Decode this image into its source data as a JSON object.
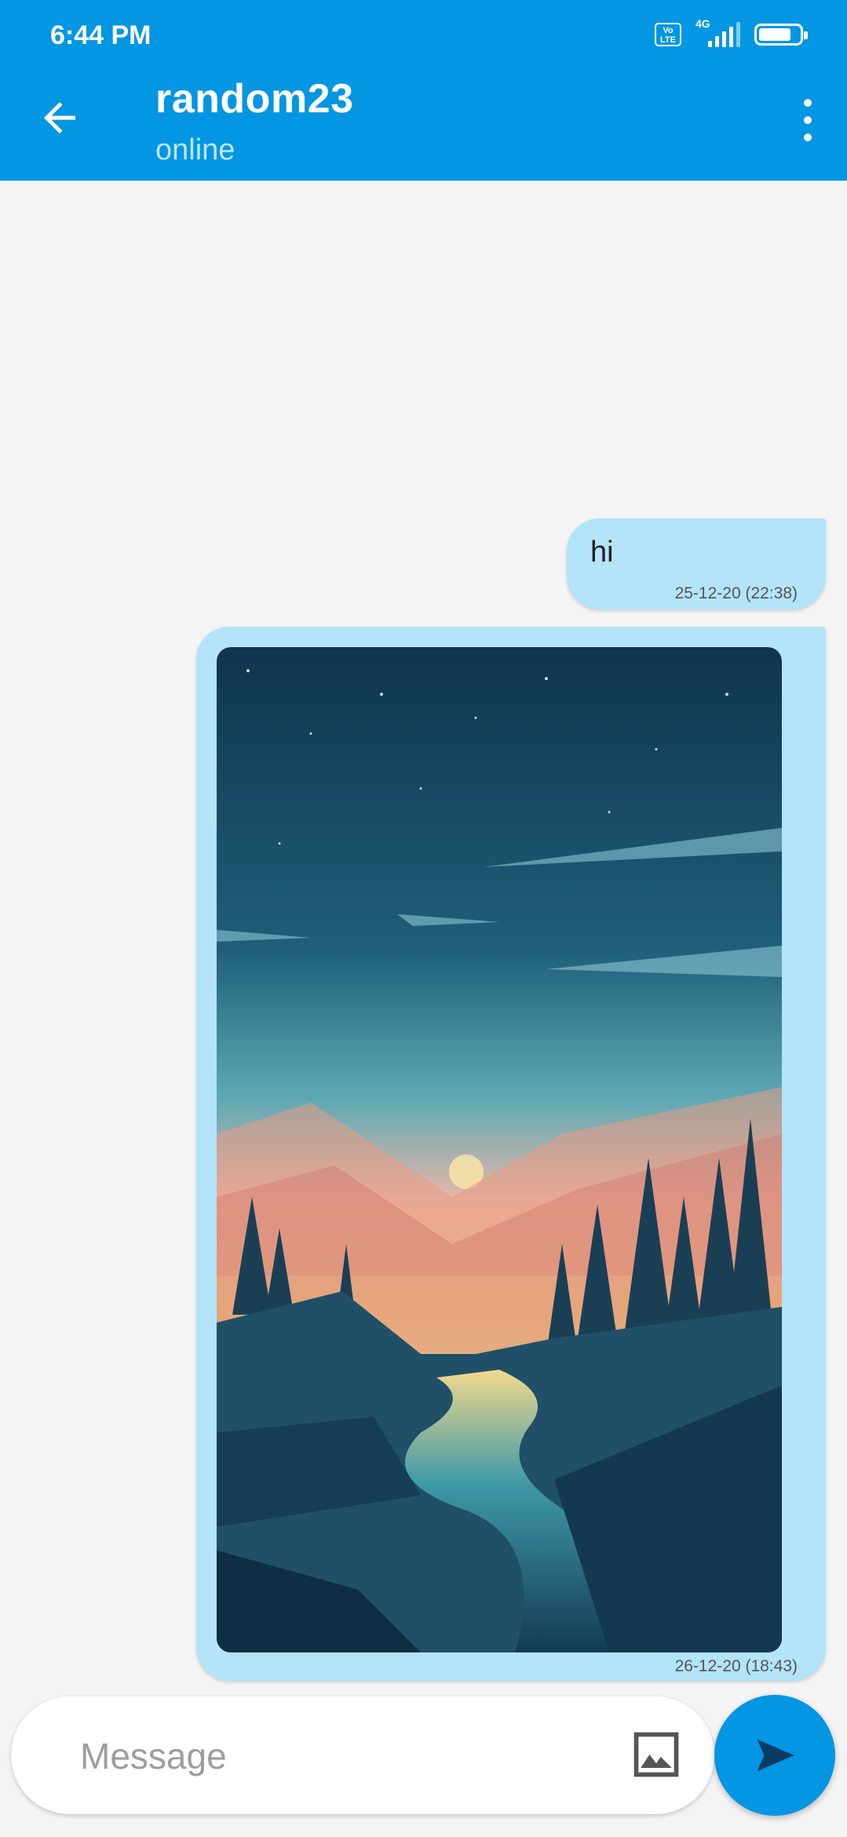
{
  "status_bar": {
    "time": "6:44 PM",
    "volte": "Vo LTE",
    "network": "4G",
    "battery_level": 0.8
  },
  "header": {
    "back_icon": "arrow-left-icon",
    "title": "random23",
    "subtitle": "online",
    "menu_icon": "more-vert-icon"
  },
  "messages": [
    {
      "type": "text",
      "text": "hi",
      "timestamp": "25-12-20 (22:38)"
    },
    {
      "type": "image",
      "image_description_icon": "landscape-photo",
      "timestamp": "26-12-20 (18:43)"
    }
  ],
  "composer": {
    "placeholder": "Message",
    "gallery_icon": "image-icon",
    "send_icon": "send-icon"
  },
  "colors": {
    "primary": "#0396e3",
    "bubble": "#b3e4fa",
    "background": "#f4f4f4"
  }
}
